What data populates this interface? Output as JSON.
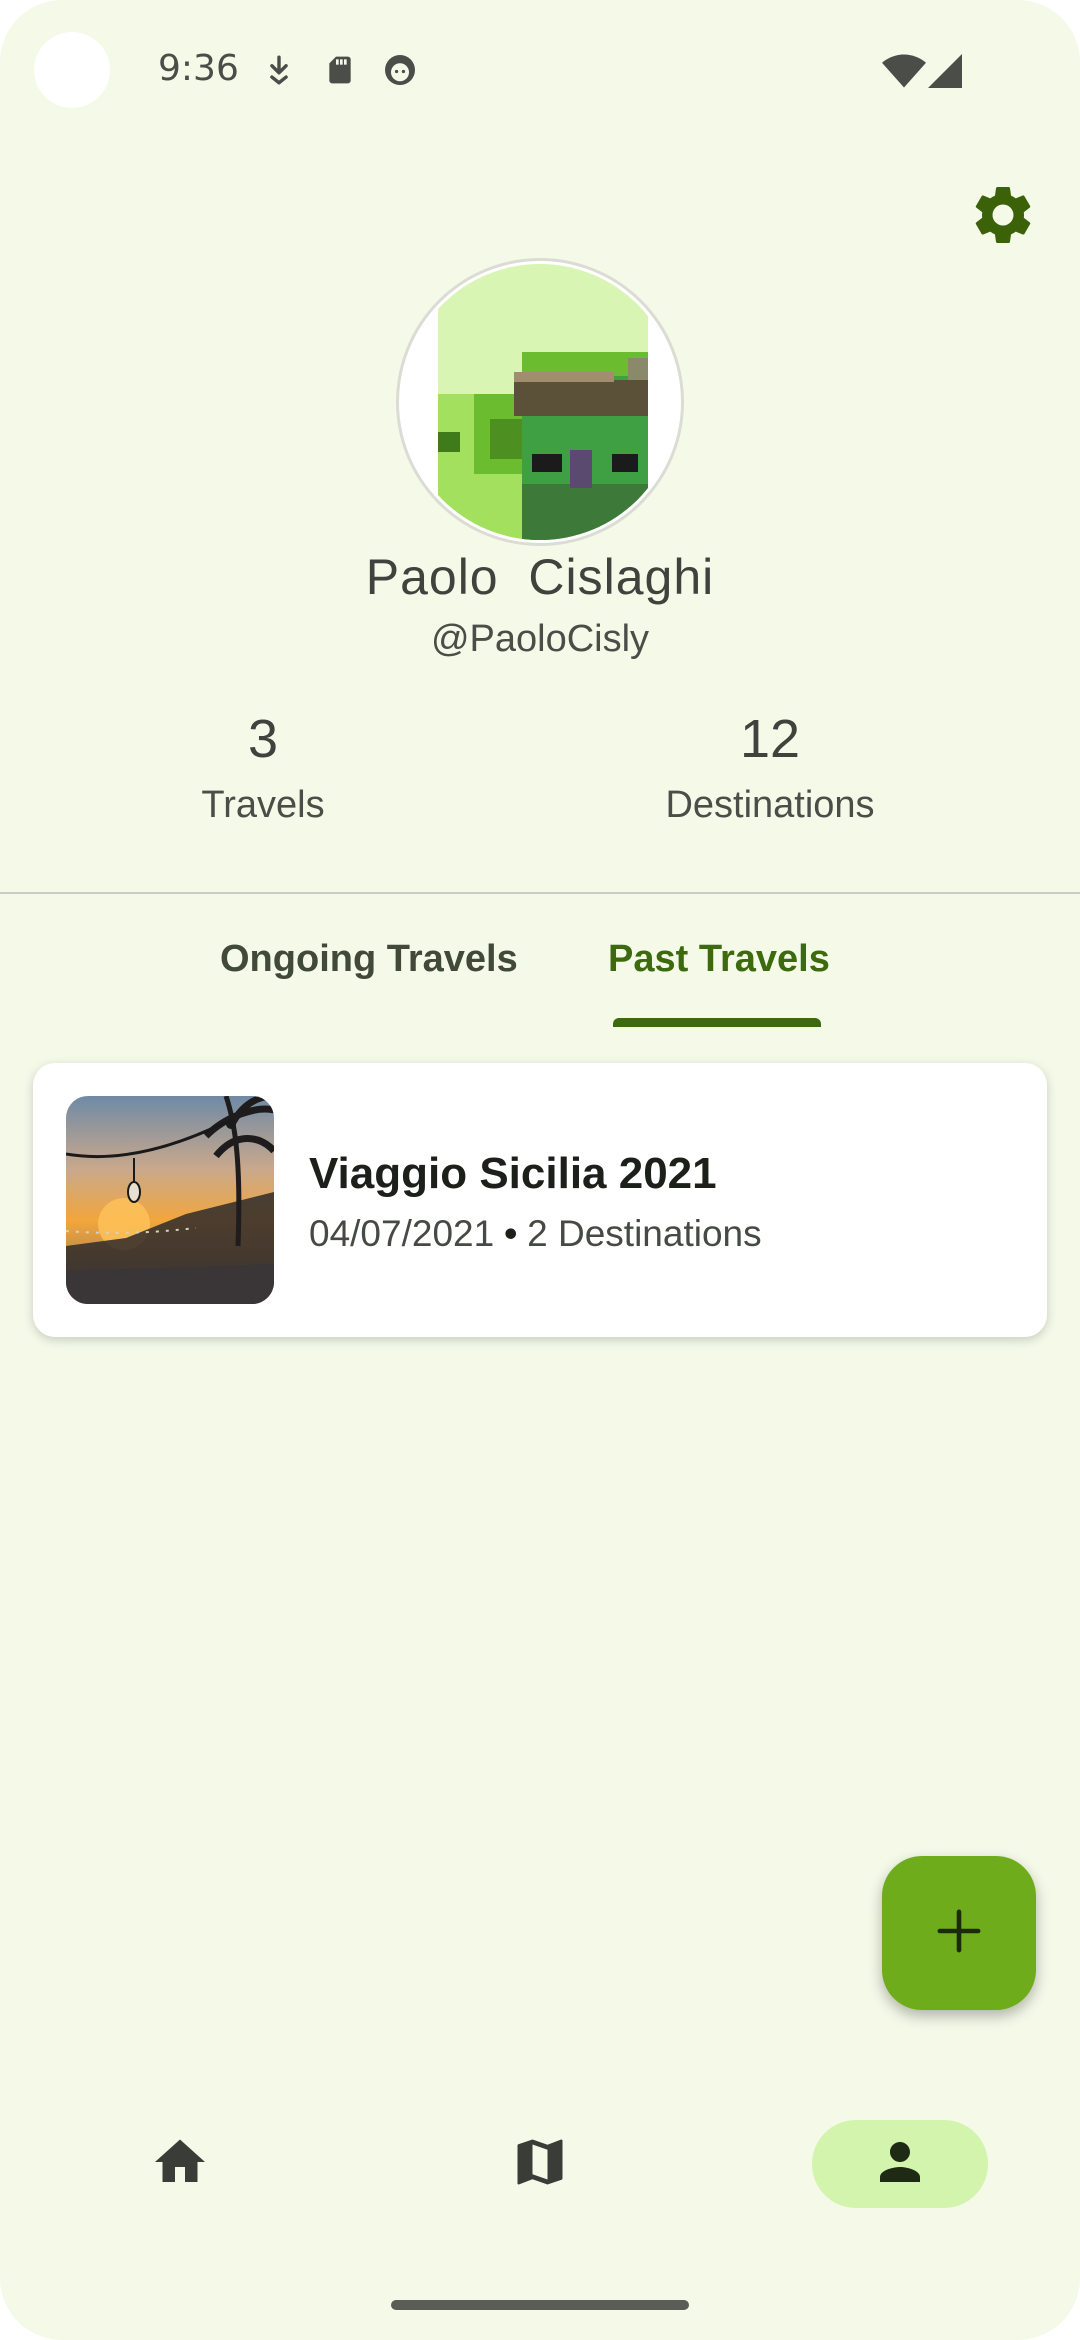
{
  "status_bar": {
    "time": "9:36",
    "left_icons": [
      "download-icon",
      "sd-card-icon",
      "face-icon"
    ],
    "right_icons": [
      "wifi-icon",
      "cell-signal-icon"
    ]
  },
  "header": {
    "settings_icon": "gear-icon"
  },
  "profile": {
    "name": "Paolo  Cislaghi",
    "handle": "@PaoloCisly",
    "stats": [
      {
        "value": "3",
        "label": "Travels"
      },
      {
        "value": "12",
        "label": "Destinations"
      }
    ]
  },
  "tabs": [
    {
      "label": "Ongoing Travels",
      "active": false
    },
    {
      "label": "Past Travels",
      "active": true
    }
  ],
  "travels": [
    {
      "title": "Viaggio Sicilia 2021",
      "date": "04/07/2021",
      "separator": "•",
      "destinations": "2 Destinations"
    }
  ],
  "fab": {
    "icon": "plus-icon"
  },
  "bottom_nav": [
    {
      "icon": "home-icon",
      "active": false
    },
    {
      "icon": "map-icon",
      "active": false
    },
    {
      "icon": "person-icon",
      "active": true
    }
  ],
  "colors": {
    "background": "#f4f9e8",
    "accent": "#3c6a0c",
    "fab": "#6fac1c",
    "nav_active": "#d3f4ad"
  }
}
